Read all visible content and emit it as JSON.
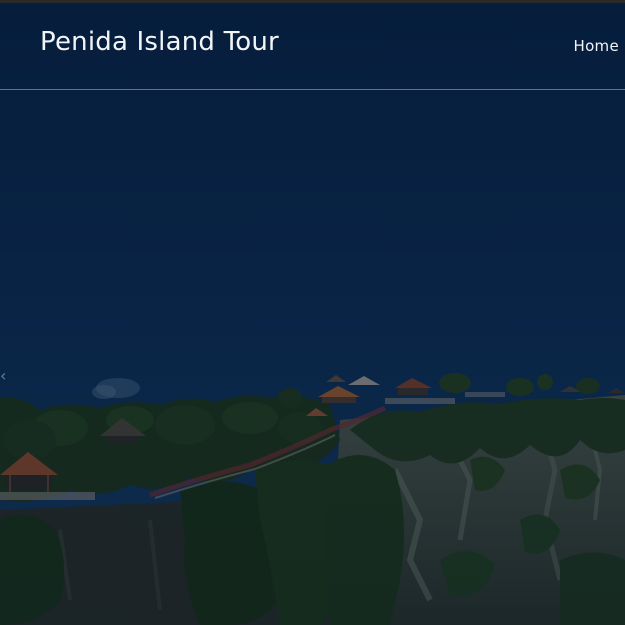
{
  "header": {
    "brand": "Penida Island Tour",
    "nav": [
      {
        "label": "Home"
      }
    ]
  },
  "hero": {
    "image": "cliff-temple-landscape",
    "prev_icon": "chevron-left-icon"
  },
  "colors": {
    "sky_top": "#0a2446",
    "sky_bottom": "#11355a",
    "text": "#f2f5f8",
    "divider": "#aabed2"
  }
}
